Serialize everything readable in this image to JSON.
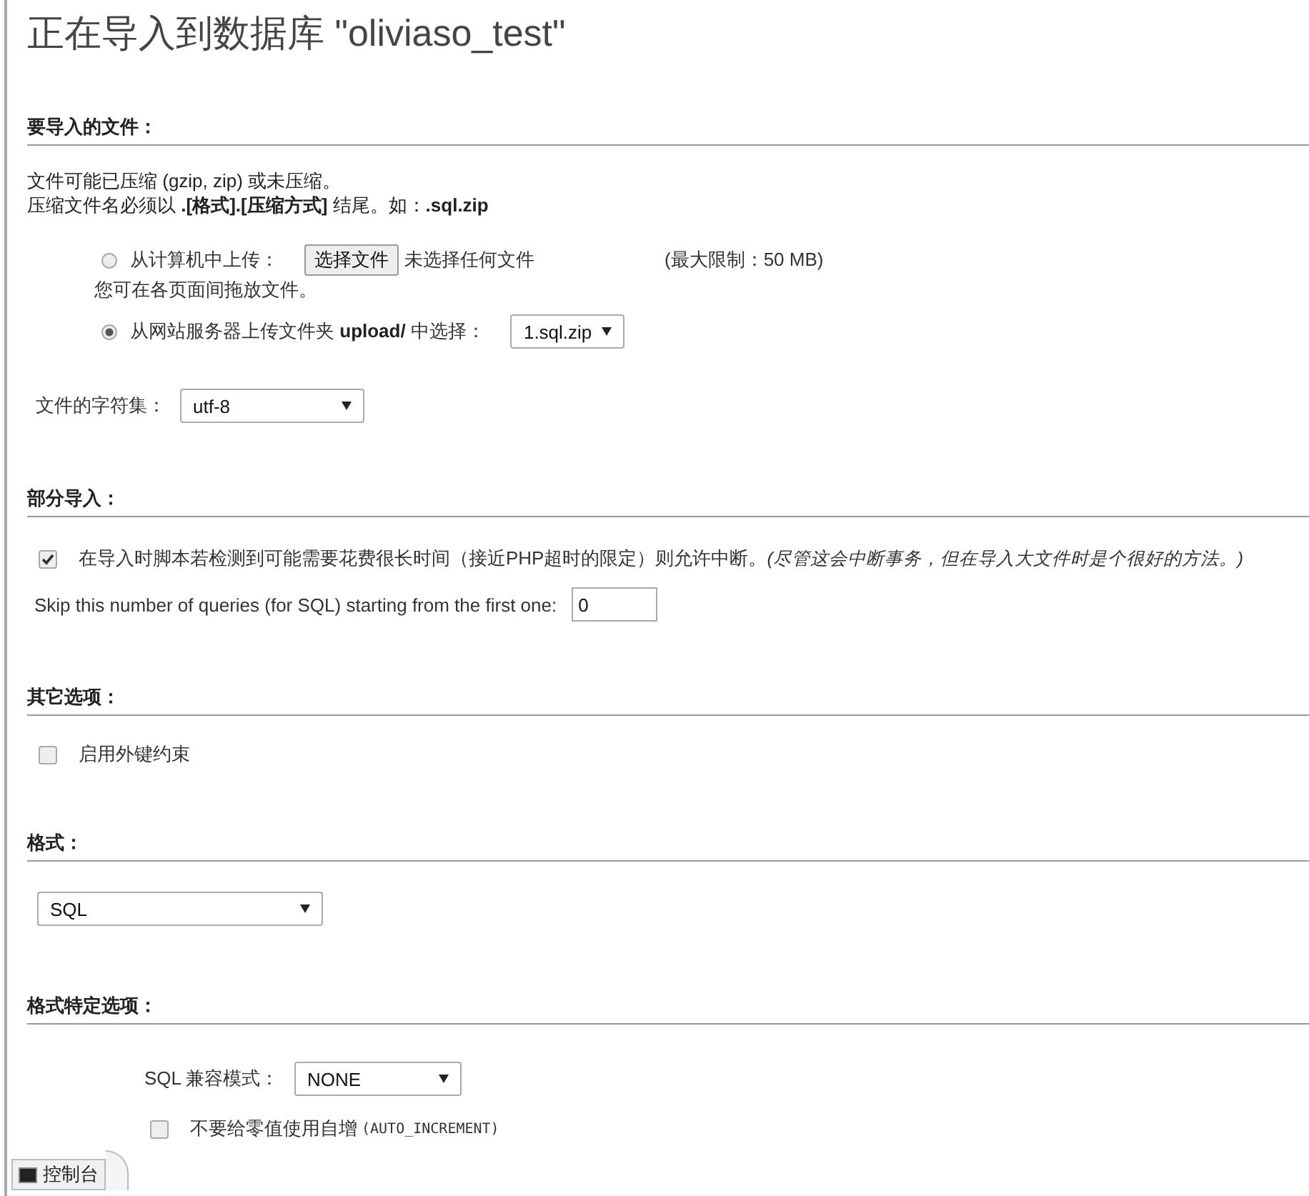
{
  "title": "正在导入到数据库 \"oliviaso_test\"",
  "file_section": {
    "heading": "要导入的文件：",
    "notes": [
      "文件可能已压缩 (gzip, zip) 或未压缩。",
      "压缩文件名必须以 **.[格式].[压缩方式]** 结尾。如：**.sql.zip**"
    ],
    "upload_options": [
      {
        "kind": "computer",
        "label": "从计算机中上传：",
        "selected": false,
        "button": "选择文件",
        "status": "未选择任何文件",
        "limit": "(最大限制：50 MB)",
        "hint": "您可在各页面间拖放文件。"
      },
      {
        "kind": "server",
        "label": "从网站服务器上传文件夹 **upload/** 中选择：",
        "selected": true,
        "value": "1.sql.zip"
      }
    ],
    "charset": {
      "label": "文件的字符集：",
      "value": "utf-8"
    }
  },
  "partial_section": {
    "heading": "部分导入：",
    "interrupt": {
      "checked": true,
      "label": "在导入时脚本若检测到可能需要花费很长时间（接近PHP超时的限定）则允许中断。",
      "note": "(尽管这会中断事务，但在导入大文件时是个很好的方法。)"
    },
    "skip": {
      "label": "Skip this number of queries (for SQL) starting from the first one:",
      "value": "0"
    }
  },
  "other_section": {
    "heading": "其它选项：",
    "options": [
      {
        "label": "启用外键约束",
        "checked": false
      }
    ]
  },
  "format_section": {
    "heading": "格式：",
    "value": "SQL"
  },
  "specific_section": {
    "heading": "格式特定选项：",
    "compat": {
      "label": "SQL 兼容模式：",
      "value": "NONE"
    },
    "options": [
      {
        "label": "不要给零值使用自增",
        "code": "(AUTO_INCREMENT)",
        "checked": false
      }
    ]
  },
  "console": {
    "label": "控制台"
  }
}
